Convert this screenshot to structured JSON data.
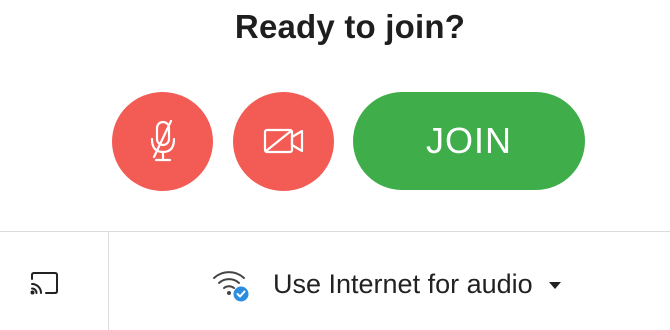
{
  "header": {
    "title": "Ready to join?"
  },
  "controls": {
    "mic_button": {
      "icon": "microphone-muted-icon",
      "state": "muted"
    },
    "video_button": {
      "icon": "video-off-icon",
      "state": "off"
    },
    "join_label": "JOIN"
  },
  "footer": {
    "cast_icon": "cast-icon",
    "audio_option": {
      "icon": "wifi-check-icon",
      "label": "Use Internet for audio",
      "dropdown_icon": "caret-down-icon"
    }
  },
  "colors": {
    "muted": "#f35b55",
    "join": "#3fae4a",
    "check_badge": "#2a8de0"
  }
}
